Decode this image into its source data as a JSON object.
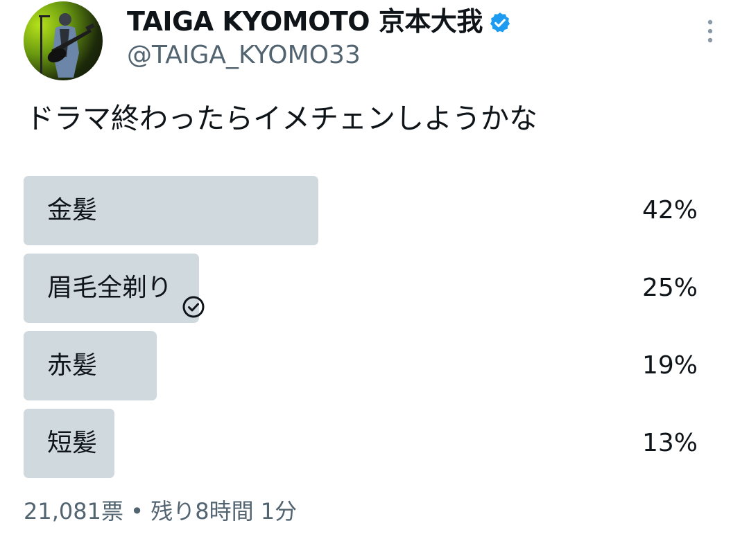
{
  "header": {
    "display_name": "TAIGA KYOMOTO 京本大我",
    "handle": "@TAIGA_KYOMO33",
    "verified_icon": "verified-badge-icon",
    "more_icon": "more-vertical-icon"
  },
  "tweet": {
    "text": "ドラマ終わったらイメチェンしようかな"
  },
  "poll": {
    "options": [
      {
        "label": "金髪",
        "percent_text": "42%",
        "percent": 42,
        "selected": false
      },
      {
        "label": "眉毛全剃り",
        "percent_text": "25%",
        "percent": 25,
        "selected": true
      },
      {
        "label": "赤髪",
        "percent_text": "19%",
        "percent": 19,
        "selected": false
      },
      {
        "label": "短髪",
        "percent_text": "13%",
        "percent": 13,
        "selected": false
      }
    ],
    "votes": "21,081票",
    "separator": "•",
    "time_left": "残り8時間 1分",
    "bar_color": "#cfd9de"
  },
  "colors": {
    "text": "#0f1419",
    "secondary": "#536471",
    "verified": "#1d9bf0"
  }
}
